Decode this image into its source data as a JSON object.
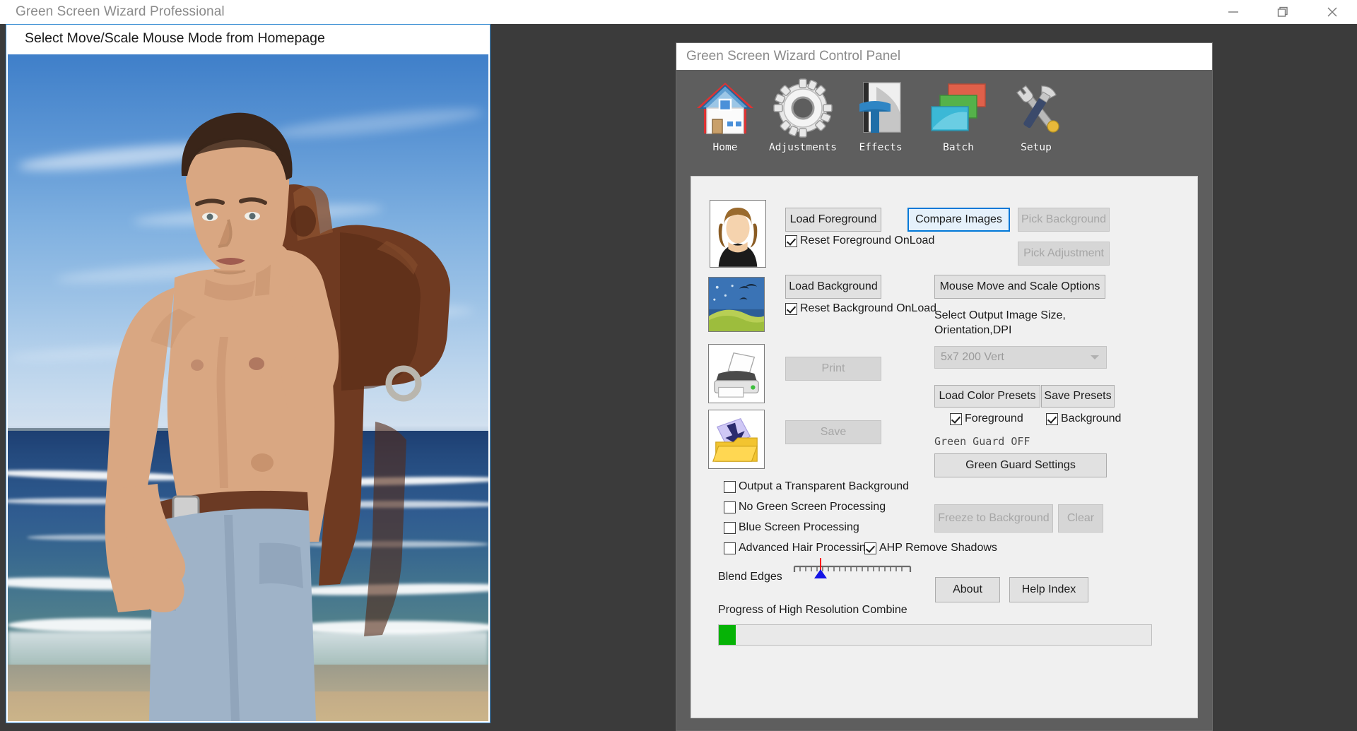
{
  "window": {
    "title": "Green Screen Wizard Professional",
    "controls": [
      {
        "name": "minimize",
        "glyph": "minimize-icon"
      },
      {
        "name": "restore",
        "glyph": "restore-icon"
      },
      {
        "name": "close",
        "glyph": "close-icon"
      }
    ]
  },
  "preview": {
    "header_text": "Select Move/Scale Mouse Mode from Homepage",
    "image_description": "Composited photo: shirtless man carrying a leather saddle over his shoulder on a beach with ocean and blue sky"
  },
  "control_panel": {
    "title": "Green Screen Wizard Control Panel",
    "toolbar": [
      {
        "label": "Home",
        "icon": "home-icon"
      },
      {
        "label": "Adjustments",
        "icon": "gear-icon"
      },
      {
        "label": "Effects",
        "icon": "text-effects-icon"
      },
      {
        "label": "Batch",
        "icon": "stacked-squares-icon"
      },
      {
        "label": "Setup",
        "icon": "tools-icon"
      }
    ],
    "buttons": {
      "load_foreground": "Load Foreground",
      "compare_images": "Compare Images",
      "pick_background": "Pick Background",
      "pick_adjustment": "Pick Adjustment",
      "load_background": "Load Background",
      "mouse_move_scale": "Mouse Move and Scale Options",
      "print": "Print",
      "save": "Save",
      "load_color_presets": "Load Color Presets",
      "save_presets": "Save Presets",
      "green_guard_settings": "Green Guard Settings",
      "freeze_to_background": "Freeze to Background",
      "clear": "Clear",
      "about": "About",
      "help_index": "Help Index"
    },
    "checkboxes": {
      "reset_foreground_onload": {
        "label": "Reset Foreground OnLoad",
        "checked": true
      },
      "reset_background_onload": {
        "label": "Reset Background OnLoad",
        "checked": true
      },
      "preset_foreground": {
        "label": "Foreground",
        "checked": true
      },
      "preset_background": {
        "label": "Background",
        "checked": true
      },
      "output_transparent": {
        "label": "Output a Transparent Background",
        "checked": false
      },
      "no_green_screen": {
        "label": "No Green Screen Processing",
        "checked": false
      },
      "blue_screen": {
        "label": "Blue Screen Processing",
        "checked": false
      },
      "advanced_hair": {
        "label": "Advanced Hair Processing",
        "checked": false
      },
      "ahp_remove_shadows": {
        "label": "AHP Remove Shadows",
        "checked": true
      }
    },
    "labels": {
      "output_size": "Select Output Image Size,\nOrientation,DPI",
      "green_guard_status": "Green Guard OFF",
      "blend_edges": "Blend Edges",
      "progress": "Progress of High Resolution Combine"
    },
    "output_size_select": {
      "value": "5x7 200 Vert",
      "options": [
        "5x7 200 Vert"
      ]
    },
    "blend_edges_slider": {
      "value_percent": 22,
      "ticks": 21
    },
    "progress": {
      "percent": 4
    },
    "thumbnails": [
      {
        "name": "foreground-thumbnail",
        "icon": "person-portrait-icon"
      },
      {
        "name": "background-thumbnail",
        "icon": "landscape-birds-icon"
      },
      {
        "name": "print-thumbnail",
        "icon": "printer-icon"
      },
      {
        "name": "save-thumbnail",
        "icon": "save-folder-icon"
      }
    ],
    "colors": {
      "accent": "#0078d7",
      "progress_fill": "#06b306",
      "panel_bg": "#f0f0f0",
      "window_chrome": "#5e5e5e",
      "desktop": "#3b3b3b"
    }
  }
}
